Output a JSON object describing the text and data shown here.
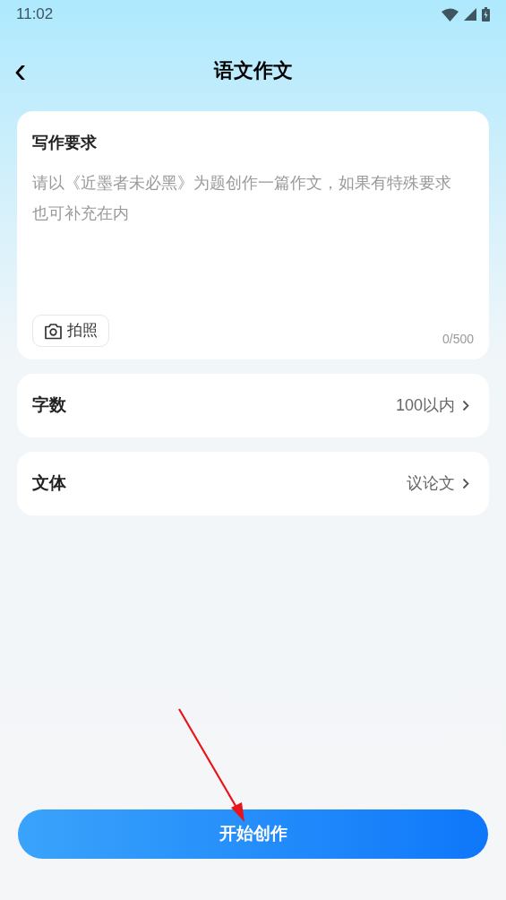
{
  "status_bar": {
    "time": "11:02"
  },
  "header": {
    "back": "‹",
    "title": "语文作文"
  },
  "requirements": {
    "title": "写作要求",
    "placeholder": "请以《近墨者未必黑》为题创作一篇作文，如果有特殊要求也可补充在内",
    "photo_button": "拍照",
    "counter": "0/500"
  },
  "options": [
    {
      "label": "字数",
      "value": "100以内"
    },
    {
      "label": "文体",
      "value": "议论文"
    }
  ],
  "start_button": "开始创作"
}
